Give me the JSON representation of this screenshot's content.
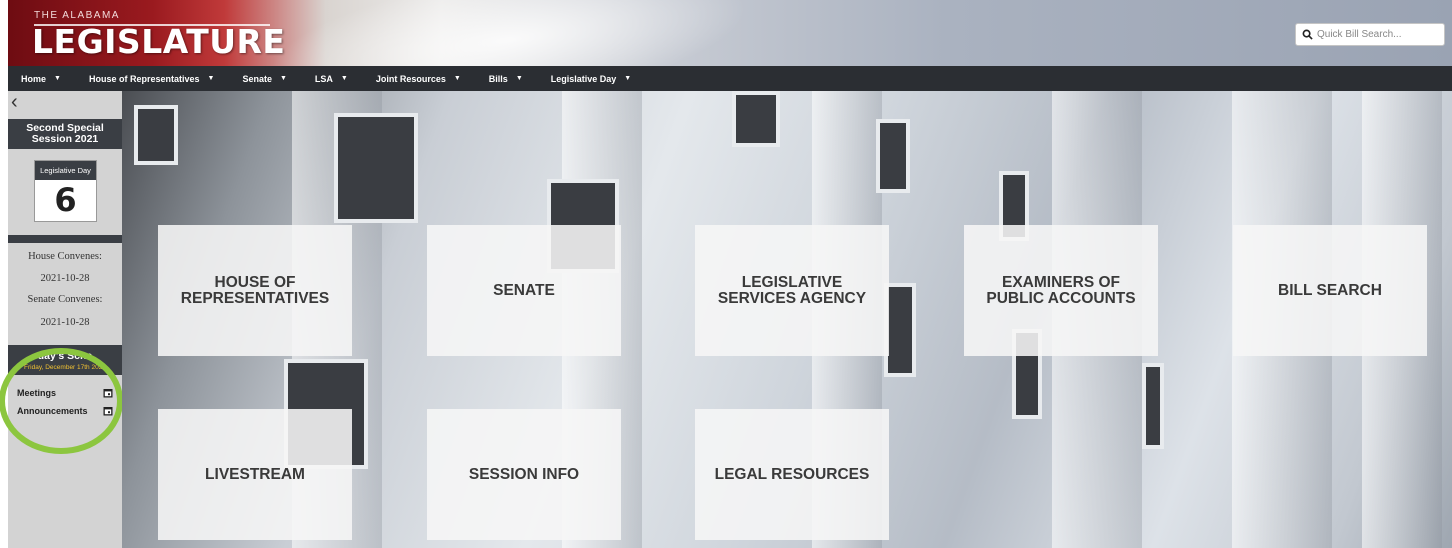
{
  "header": {
    "logo_top": "THE ALABAMA",
    "logo_main": "LEGISLATURE",
    "search_placeholder": "Quick Bill Search..."
  },
  "nav": [
    {
      "label": "Home"
    },
    {
      "label": "House of Representatives"
    },
    {
      "label": "Senate"
    },
    {
      "label": "LSA"
    },
    {
      "label": "Joint Resources"
    },
    {
      "label": "Bills"
    },
    {
      "label": "Legislative Day"
    }
  ],
  "sidebar": {
    "session_line1": "Second Special",
    "session_line2": "Session 2021",
    "legislative_day_label": "Legislative Day",
    "legislative_day_number": "6",
    "house_convenes_label": "House Convenes:",
    "house_convenes_date": "2021-10-28",
    "senate_convenes_label": "Senate Convenes:",
    "senate_convenes_date": "2021-10-28",
    "schedule_title": "day's Sche",
    "schedule_date": "Friday, December 17th 2021",
    "links": [
      "Meetings",
      "Announcements"
    ]
  },
  "tiles": [
    {
      "line1": "HOUSE OF",
      "line2": "REPRESENTATIVES"
    },
    {
      "line1": "SENATE",
      "line2": ""
    },
    {
      "line1": "LEGISLATIVE",
      "line2": "SERVICES AGENCY"
    },
    {
      "line1": "EXAMINERS OF",
      "line2": "PUBLIC ACCOUNTS"
    },
    {
      "line1": "BILL SEARCH",
      "line2": ""
    },
    {
      "line1": "LIVESTREAM",
      "line2": ""
    },
    {
      "line1": "SESSION INFO",
      "line2": ""
    },
    {
      "line1": "LEGAL RESOURCES",
      "line2": ""
    }
  ],
  "colors": {
    "nav_bg": "#2b2e33",
    "sidebar_bg": "#d3d3d3",
    "highlight_circle": "#8cc63f",
    "schedule_date": "#f1c232"
  }
}
